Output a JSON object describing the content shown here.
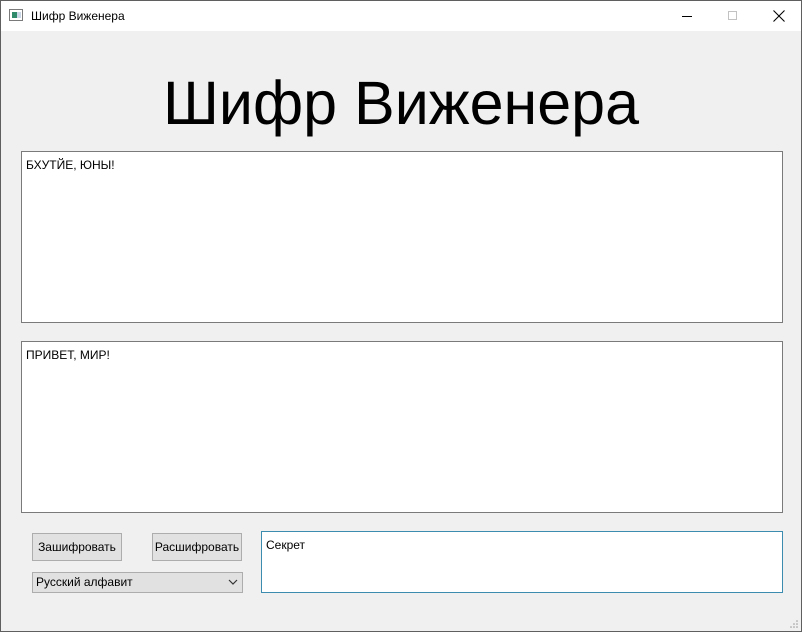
{
  "window": {
    "title": "Шифр Виженера"
  },
  "heading": "Шифр Виженера",
  "encrypted_text": "БХУТЙЕ, ЮНЫ!",
  "plain_text": "ПРИВЕТ, МИР!",
  "controls": {
    "encrypt_label": "Зашифровать",
    "decrypt_label": "Расшифровать",
    "alphabet_selected": "Русский алфавит",
    "key_value": "Секрет"
  },
  "icons": {
    "app": "window-app-icon",
    "minimize": "minimize-icon",
    "maximize": "maximize-icon",
    "close": "close-icon",
    "dropdown": "chevron-down-icon",
    "grip": "resize-grip-icon"
  },
  "colors": {
    "window_bg": "#f0f0f0",
    "field_bg": "#ffffff",
    "field_border": "#7a7a7a",
    "focused_border": "#3c8cb0",
    "button_bg": "#e1e1e1"
  }
}
